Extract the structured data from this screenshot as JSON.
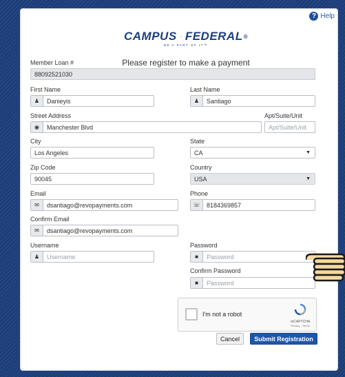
{
  "help_label": "Help",
  "logo": {
    "brand_left": "CAMPUS",
    "brand_right": "FEDERAL",
    "registered": "®",
    "tagline": "BE A PART OF IT™"
  },
  "subtitle": "Please register to make a payment",
  "member_loan": {
    "label": "Member Loan #",
    "value": "88092521030"
  },
  "first_name": {
    "label": "First Name",
    "value": "Danieyis"
  },
  "last_name": {
    "label": "Last Name",
    "value": "Santiago"
  },
  "street": {
    "label": "Street Address",
    "value": "Manchester Blvd"
  },
  "apt": {
    "label": "Apt/Suite/Unit",
    "placeholder": "Apt/Suite/Unit"
  },
  "city": {
    "label": "City",
    "value": "Los Angeles"
  },
  "state": {
    "label": "State",
    "value": "CA"
  },
  "zip": {
    "label": "Zip Code",
    "value": "90045"
  },
  "country": {
    "label": "Country",
    "value": "USA"
  },
  "email": {
    "label": "Email",
    "value": "dsantiago@revopayments.com"
  },
  "phone": {
    "label": "Phone",
    "value": "8184369857"
  },
  "confirm_email": {
    "label": "Confirm Email",
    "value": "dsantiago@revopayments.com"
  },
  "username": {
    "label": "Username",
    "placeholder": "Username"
  },
  "password": {
    "label": "Password",
    "placeholder": "Password"
  },
  "confirm_password": {
    "label": "Confirm Password",
    "placeholder": "Password"
  },
  "captcha": {
    "label": "I'm not a robot",
    "brand": "reCAPTCHA",
    "links": "Privacy - Terms"
  },
  "buttons": {
    "cancel": "Cancel",
    "submit": "Submit Registration"
  },
  "colors": {
    "background": "#1c3d78",
    "primary": "#1f56a8",
    "brand": "#1d3f7f"
  }
}
